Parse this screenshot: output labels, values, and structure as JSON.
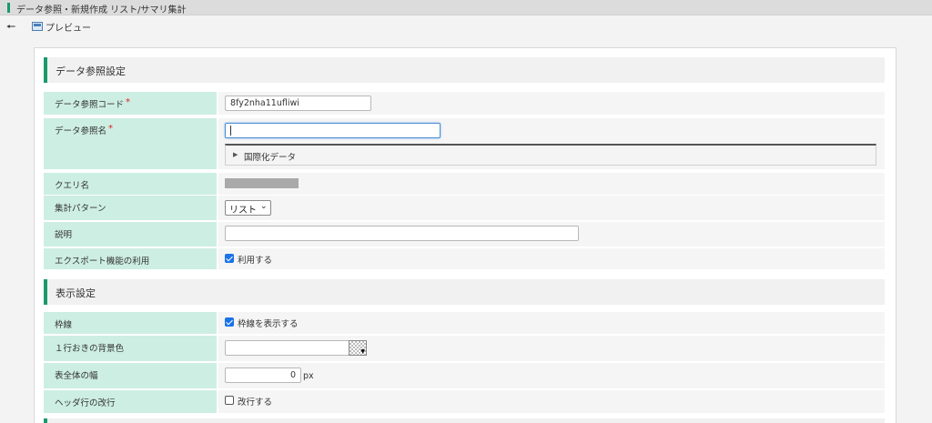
{
  "window": {
    "title": "データ参照・新規作成 リスト/サマリ集計"
  },
  "toolbar": {
    "preview_label": "プレビュー"
  },
  "sections": {
    "data_ref": "データ参照設定",
    "display": "表示設定"
  },
  "fields": {
    "code": {
      "label": "データ参照コード",
      "required": "*",
      "value": "8fy2nha11ufliwi"
    },
    "name": {
      "label": "データ参照名",
      "required": "*",
      "value": "",
      "i18n_label": "国際化データ"
    },
    "query": {
      "label": "クエリ名"
    },
    "pattern": {
      "label": "集計パターン",
      "selected": "リスト"
    },
    "description": {
      "label": "説明",
      "value": ""
    },
    "export": {
      "label": "エクスポート機能の利用",
      "checkbox_label": "利用する",
      "checked": true
    },
    "border": {
      "label": "枠線",
      "checkbox_label": "枠線を表示する",
      "checked": true
    },
    "alt_bg": {
      "label": "１行おきの背景色",
      "value": ""
    },
    "table_width": {
      "label": "表全体の幅",
      "value": "0",
      "unit": "px"
    },
    "header_wrap": {
      "label": "ヘッダ行の改行",
      "checkbox_label": "改行する",
      "checked": false
    }
  },
  "colors": {
    "accent": "#1a9a6c",
    "label_bg": "#cdeee3",
    "checkbox": "#1a73e8",
    "required": "#e02020"
  }
}
